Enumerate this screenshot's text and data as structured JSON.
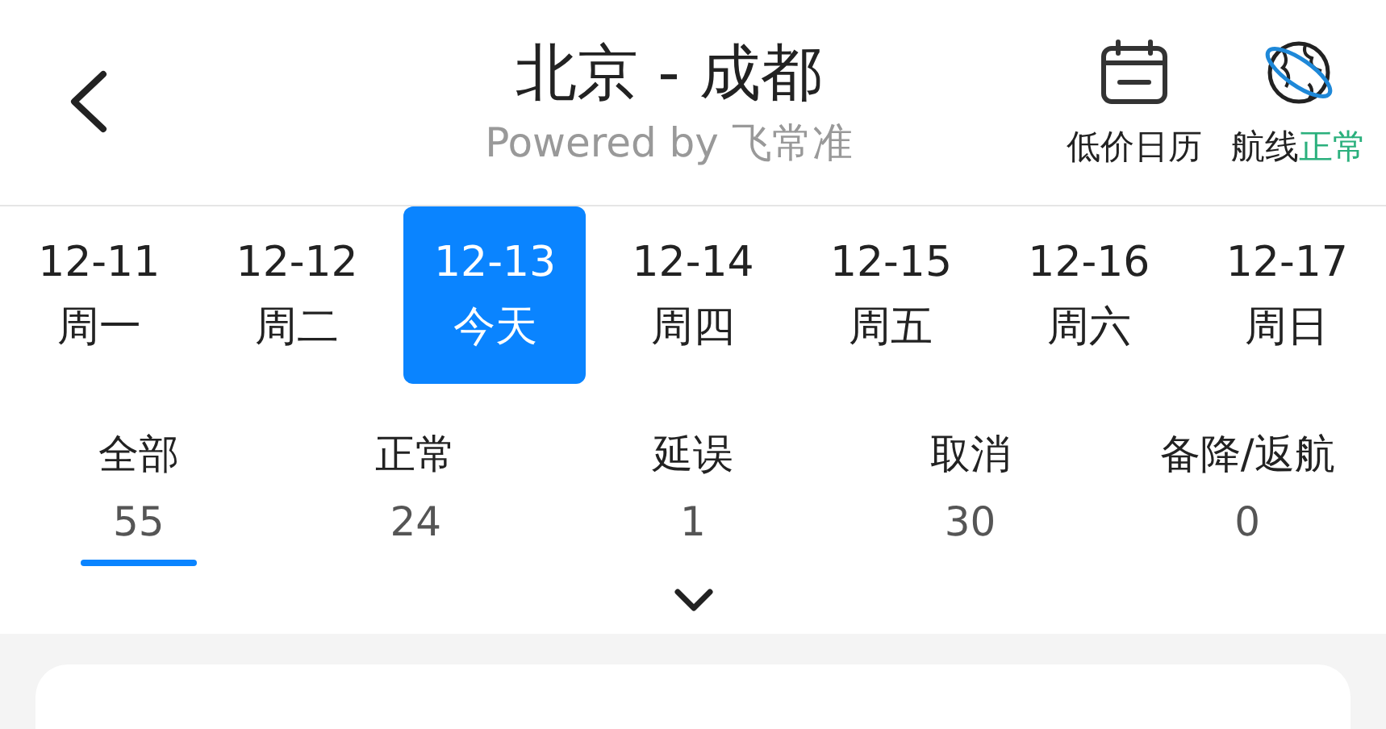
{
  "header": {
    "title": "北京 - 成都",
    "subtitle": "Powered by 飞常准",
    "actions": [
      {
        "kind": "calendar",
        "label": "低价日历"
      },
      {
        "kind": "globe",
        "label": "航线",
        "status": "正常"
      }
    ]
  },
  "dates": [
    {
      "date": "12-11",
      "day": "周一",
      "selected": false
    },
    {
      "date": "12-12",
      "day": "周二",
      "selected": false
    },
    {
      "date": "12-13",
      "day": "今天",
      "selected": true
    },
    {
      "date": "12-14",
      "day": "周四",
      "selected": false
    },
    {
      "date": "12-15",
      "day": "周五",
      "selected": false
    },
    {
      "date": "12-16",
      "day": "周六",
      "selected": false
    },
    {
      "date": "12-17",
      "day": "周日",
      "selected": false
    }
  ],
  "filters": [
    {
      "label": "全部",
      "count": "55",
      "selected": true
    },
    {
      "label": "正常",
      "count": "24",
      "selected": false
    },
    {
      "label": "延误",
      "count": "1",
      "selected": false
    },
    {
      "label": "取消",
      "count": "30",
      "selected": false
    },
    {
      "label": "备降/返航",
      "count": "0",
      "selected": false
    }
  ]
}
